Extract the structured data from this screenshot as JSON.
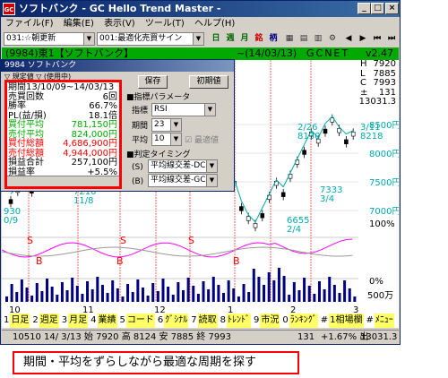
{
  "window": {
    "title": "ソフトバンク - GC Hello Trend Master -",
    "app_icon": "GC"
  },
  "menu": [
    "ファイル(F)",
    "編集(E)",
    "表示(V)",
    "ツール(T)",
    "ヘルプ(H)"
  ],
  "toolbar": {
    "stock_combo": "031:☆朝更新",
    "strategy_combo": "001:最適化売買サイン",
    "icons": [
      "日",
      "週",
      "月",
      "銘",
      "柄"
    ]
  },
  "infobar": {
    "text": "(9984)東1【ソフトバンク】",
    "period": "~(14/03/13)",
    "source": "GCNET",
    "version": "v2.47"
  },
  "subwindow": {
    "title": "9984 ソフトバンク",
    "tab": "▽ 規定値  ▽ (使用中)",
    "save_button": "保存",
    "init_button": "初期値",
    "indicator_section": "■指標パラメータ",
    "indicator_label": "指標",
    "indicator_value": "RSI",
    "period_label": "期間",
    "period_value": "23",
    "avg_label": "平均",
    "avg_value": "10",
    "optimal_label": "最適値",
    "timing_section": "■判定タイミング",
    "timing_s_label": "(S)",
    "timing_s_value": "平均線交差-DC-",
    "timing_b_label": "(B)",
    "timing_b_value": "平均線交差-GC-"
  },
  "results": [
    {
      "label": "期間13/10/09~14/03/13",
      "value": "",
      "color": "#000000"
    },
    {
      "label": "売買回数",
      "value": "6回",
      "color": "#000000"
    },
    {
      "label": "勝率",
      "value": "66.7%",
      "color": "#000000"
    },
    {
      "label": "PL(益/損)",
      "value": "18.1倍",
      "color": "#000000"
    },
    {
      "label": "買付平均",
      "value": "781,150円",
      "color": "#00aa00"
    },
    {
      "label": "売付平均",
      "value": "824,000円",
      "color": "#00aa00"
    },
    {
      "label": "買付総額",
      "value": "4,686,900円",
      "color": "#ff0000"
    },
    {
      "label": "売付総額",
      "value": "4,944,000円",
      "color": "#ff0000"
    },
    {
      "label": "損益合計",
      "value": "257,100円",
      "color": "#000000"
    },
    {
      "label": "損益率",
      "value": "+5.5%",
      "color": "#000000"
    }
  ],
  "price_panel": [
    {
      "label": "H",
      "value": "7920"
    },
    {
      "label": "L",
      "value": "7885"
    },
    {
      "label": "C",
      "value": "7993"
    },
    {
      "label": "±",
      "value": "131"
    },
    {
      "label": "",
      "value": "13031.3"
    }
  ],
  "chart_data": {
    "type": "line",
    "title": "",
    "yticks": [
      "8500円",
      "8000円",
      "7500円",
      "7000円"
    ],
    "indicator_ticks": [
      "100%",
      "0%"
    ],
    "volume_tick": "500万",
    "xticks": [
      "10",
      "11",
      "12",
      "1",
      "2",
      "3"
    ],
    "annotations": [
      "7210",
      "11/8",
      "2/26",
      "8130",
      "3/11",
      "8218",
      "6655",
      "2/4",
      "7333",
      "3/4",
      "930",
      "0/9"
    ],
    "signal_labels": [
      "S",
      "B",
      "S",
      "B",
      "S",
      "B"
    ],
    "colors": {
      "candles": "#000000",
      "ma": "#00aaaa",
      "signal": "#ff0000",
      "indicator1": "#ff00ff",
      "indicator2": "#999999",
      "volume": "#000080"
    }
  },
  "legend": [
    {
      "num": "1",
      "label": "日足"
    },
    {
      "num": "2",
      "label": "週足"
    },
    {
      "num": "3",
      "label": "月足"
    },
    {
      "num": "4",
      "label": "業績"
    },
    {
      "num": "5",
      "label": "コード"
    },
    {
      "num": "6",
      "label": "ｸﾞｼﾅﾙ"
    },
    {
      "num": "7",
      "label": "読取"
    },
    {
      "num": "8",
      "label": "ﾄﾚﾝﾄﾞ"
    },
    {
      "num": "9",
      "label": "市況"
    },
    {
      "num": "0",
      "label": "ﾗﾝｷﾝｸﾞ"
    },
    {
      "num": "#",
      "label": "1相場欄"
    },
    {
      "num": "#",
      "label": "ﾒﾆｭｰ"
    }
  ],
  "status": {
    "text": "10510 14/ 3/13 始   7920 高   8124 安   7885 終   7993",
    "change": "131",
    "pct": "+1.67% 出",
    "value": "13031.3"
  },
  "caption": "期間・平均をずらしながら最適な周期を探す"
}
